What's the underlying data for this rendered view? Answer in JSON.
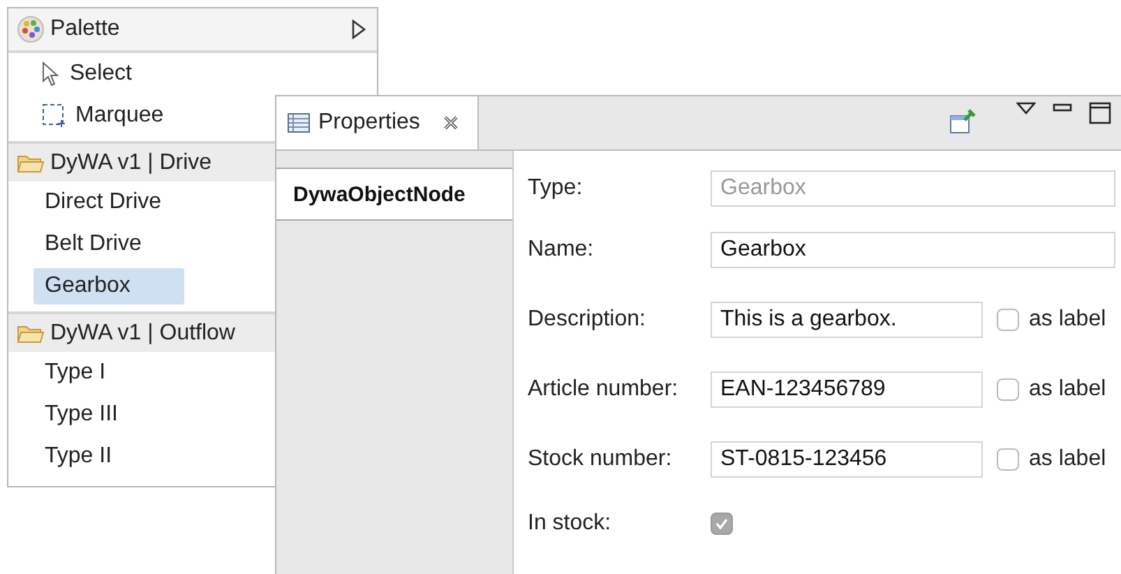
{
  "palette": {
    "title": "Palette",
    "tools": [
      {
        "kind": "select",
        "label": "Select"
      },
      {
        "kind": "marquee",
        "label": "Marquee"
      }
    ],
    "groups": [
      {
        "title": "DyWA v1 | Drive",
        "items": [
          {
            "label": "Direct Drive",
            "selected": false
          },
          {
            "label": "Belt Drive",
            "selected": false
          },
          {
            "label": "Gearbox",
            "selected": true
          }
        ]
      },
      {
        "title": "DyWA v1 | Outflow",
        "items": [
          {
            "label": "Type I",
            "selected": false
          },
          {
            "label": "Type III",
            "selected": false
          },
          {
            "label": "Type II",
            "selected": false
          }
        ]
      }
    ]
  },
  "properties": {
    "tab": {
      "label": "Properties"
    },
    "section_tabs": [
      {
        "label": "DywaObjectNode",
        "selected": true
      }
    ],
    "fields": [
      {
        "kind": "text",
        "label": "Type:",
        "value": "Gearbox",
        "disabled": true
      },
      {
        "kind": "text",
        "label": "Name:",
        "value": "Gearbox",
        "disabled": false
      },
      {
        "kind": "text",
        "label": "Description:",
        "value": "This is a gearbox.",
        "disabled": false,
        "as_label": {
          "label": "as label",
          "checked": false
        }
      },
      {
        "kind": "text",
        "label": "Article number:",
        "value": "EAN-123456789",
        "disabled": false,
        "as_label": {
          "label": "as label",
          "checked": false
        }
      },
      {
        "kind": "text",
        "label": "Stock number:",
        "value": "ST-0815-123456",
        "disabled": false,
        "as_label": {
          "label": "as label",
          "checked": false
        }
      },
      {
        "kind": "checkbox",
        "label": "In stock:",
        "checked": true,
        "disabled": true
      }
    ]
  }
}
